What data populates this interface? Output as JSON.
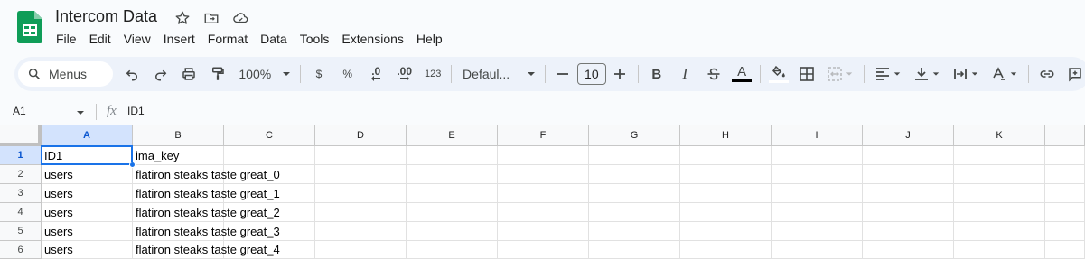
{
  "document": {
    "title": "Intercom Data"
  },
  "menubar": [
    "File",
    "Edit",
    "View",
    "Insert",
    "Format",
    "Data",
    "Tools",
    "Extensions",
    "Help"
  ],
  "toolbar": {
    "menus_label": "Menus",
    "zoom": "100%",
    "currency": "$",
    "percent": "%",
    "decrease_decimal": ".0",
    "increase_decimal": ".00",
    "number_format": "123",
    "font": "Defaul...",
    "font_size": "10",
    "bold": "B",
    "italic": "I",
    "text_color": "A"
  },
  "formula_bar": {
    "name_box": "A1",
    "fx": "fx",
    "value": "ID1"
  },
  "columns": [
    "A",
    "B",
    "C",
    "D",
    "E",
    "F",
    "G",
    "H",
    "I",
    "J",
    "K"
  ],
  "rows": [
    {
      "num": "1",
      "cells": [
        "ID1",
        "ima_key"
      ]
    },
    {
      "num": "2",
      "cells": [
        "users",
        "flatiron steaks taste great_0"
      ]
    },
    {
      "num": "3",
      "cells": [
        "users",
        "flatiron steaks taste great_1"
      ]
    },
    {
      "num": "4",
      "cells": [
        "users",
        "flatiron steaks taste great_2"
      ]
    },
    {
      "num": "5",
      "cells": [
        "users",
        "flatiron steaks taste great_3"
      ]
    },
    {
      "num": "6",
      "cells": [
        "users",
        "flatiron steaks taste great_4"
      ]
    }
  ],
  "colors": {
    "accent": "#1a73e8",
    "selected_header": "#d3e3fd",
    "logo_green": "#0f9d58"
  }
}
